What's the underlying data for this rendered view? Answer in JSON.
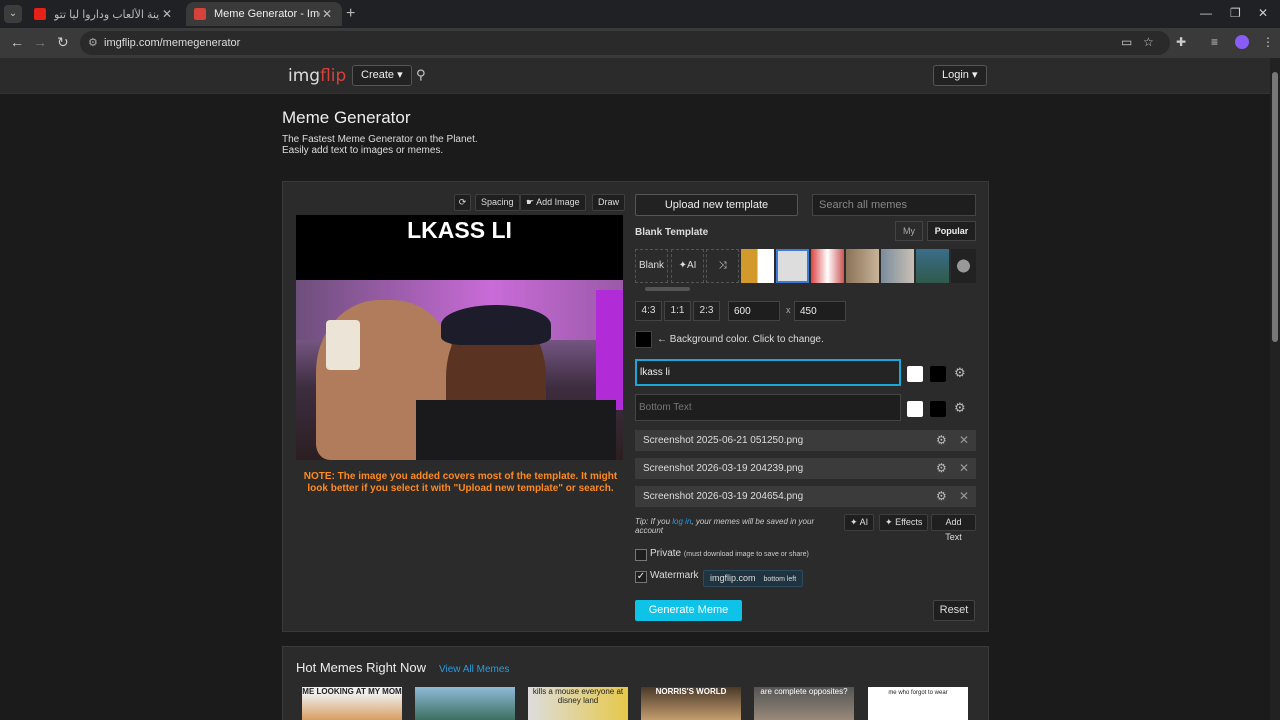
{
  "browser": {
    "tabs": [
      {
        "title": "دخلت لمدينة الألعاب وداروا ليا تتو...",
        "active": false
      },
      {
        "title": "Meme Generator - Imgflip",
        "active": true
      }
    ],
    "url": "imgflip.com/memegenerator"
  },
  "header": {
    "logo_a": "img",
    "logo_b": "flip",
    "create_label": "Create ▾",
    "login_label": "Login ▾"
  },
  "page": {
    "title": "Meme Generator",
    "subtitle": "The Fastest Meme Generator on the Planet. Easily add text to images or memes."
  },
  "canvas_toolbar": {
    "spacing": "Spacing",
    "add_image": "Add Image",
    "draw": "Draw"
  },
  "meme": {
    "top_text": "LKASS LI"
  },
  "note": "NOTE: The image you added covers most of the template. It might look better if you select it with \"Upload new template\" or search.",
  "controls": {
    "upload_template": "Upload new template",
    "search_placeholder": "Search all memes",
    "blank_template": "Blank Template",
    "tab_my": "My",
    "tab_popular": "Popular",
    "blank": "Blank",
    "ai": "AI",
    "ratios": [
      "4:3",
      "1:1",
      "2:3"
    ],
    "width": "600",
    "times": "x",
    "height": "450",
    "bg_label": "← Background color. Click to change.",
    "top_text_value": "lkass li",
    "bottom_placeholder": "Bottom Text",
    "files": [
      "Screenshot 2025-06-21 051250.png",
      "Screenshot 2026-03-19 204239.png",
      "Screenshot 2026-03-19 204654.png"
    ],
    "tip_a": "Tip: If you ",
    "tip_link": "log in",
    "tip_b": ", your memes will be saved in your account",
    "ai_btn": "AI",
    "effects_btn": "Effects",
    "add_text_btn": "Add Text",
    "private_label": "Private",
    "private_note": "(must download image to save or share)",
    "watermark_label": "Watermark",
    "watermark_site": "imgflip.com",
    "watermark_pos": "bottom left",
    "generate": "Generate Meme",
    "reset": "Reset"
  },
  "hot": {
    "title": "Hot Memes Right Now",
    "view_all": "View All Memes",
    "thumbs": [
      "ME LOOKING AT MY MOM",
      "",
      "kills a mouse everyone at disney land",
      "NORRIS'S WORLD",
      "are complete opposites?",
      "me who forgot to wear"
    ]
  },
  "colors": {
    "accent": "#0fc2e8",
    "note": "#ff8a1f",
    "link": "#2a9be0"
  }
}
